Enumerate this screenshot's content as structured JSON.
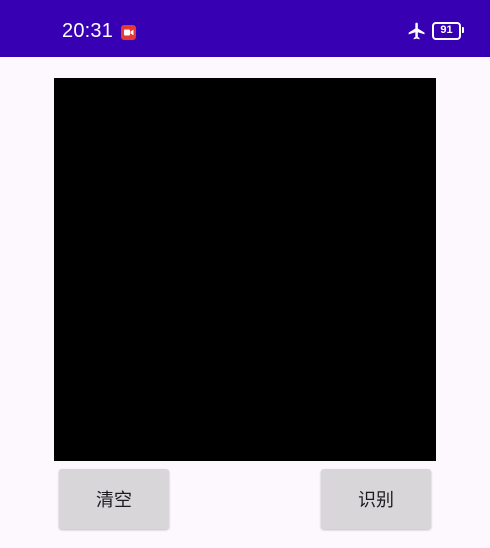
{
  "status_bar": {
    "time": "20:31",
    "battery_level": "91",
    "background_color": "#3700b3",
    "icons": [
      "screen-record-icon",
      "airplane-mode-icon",
      "battery-icon"
    ]
  },
  "canvas": {
    "background_color": "#000000"
  },
  "buttons": {
    "clear_label": "清空",
    "recognize_label": "识别",
    "background_color": "#d9d6d9"
  }
}
